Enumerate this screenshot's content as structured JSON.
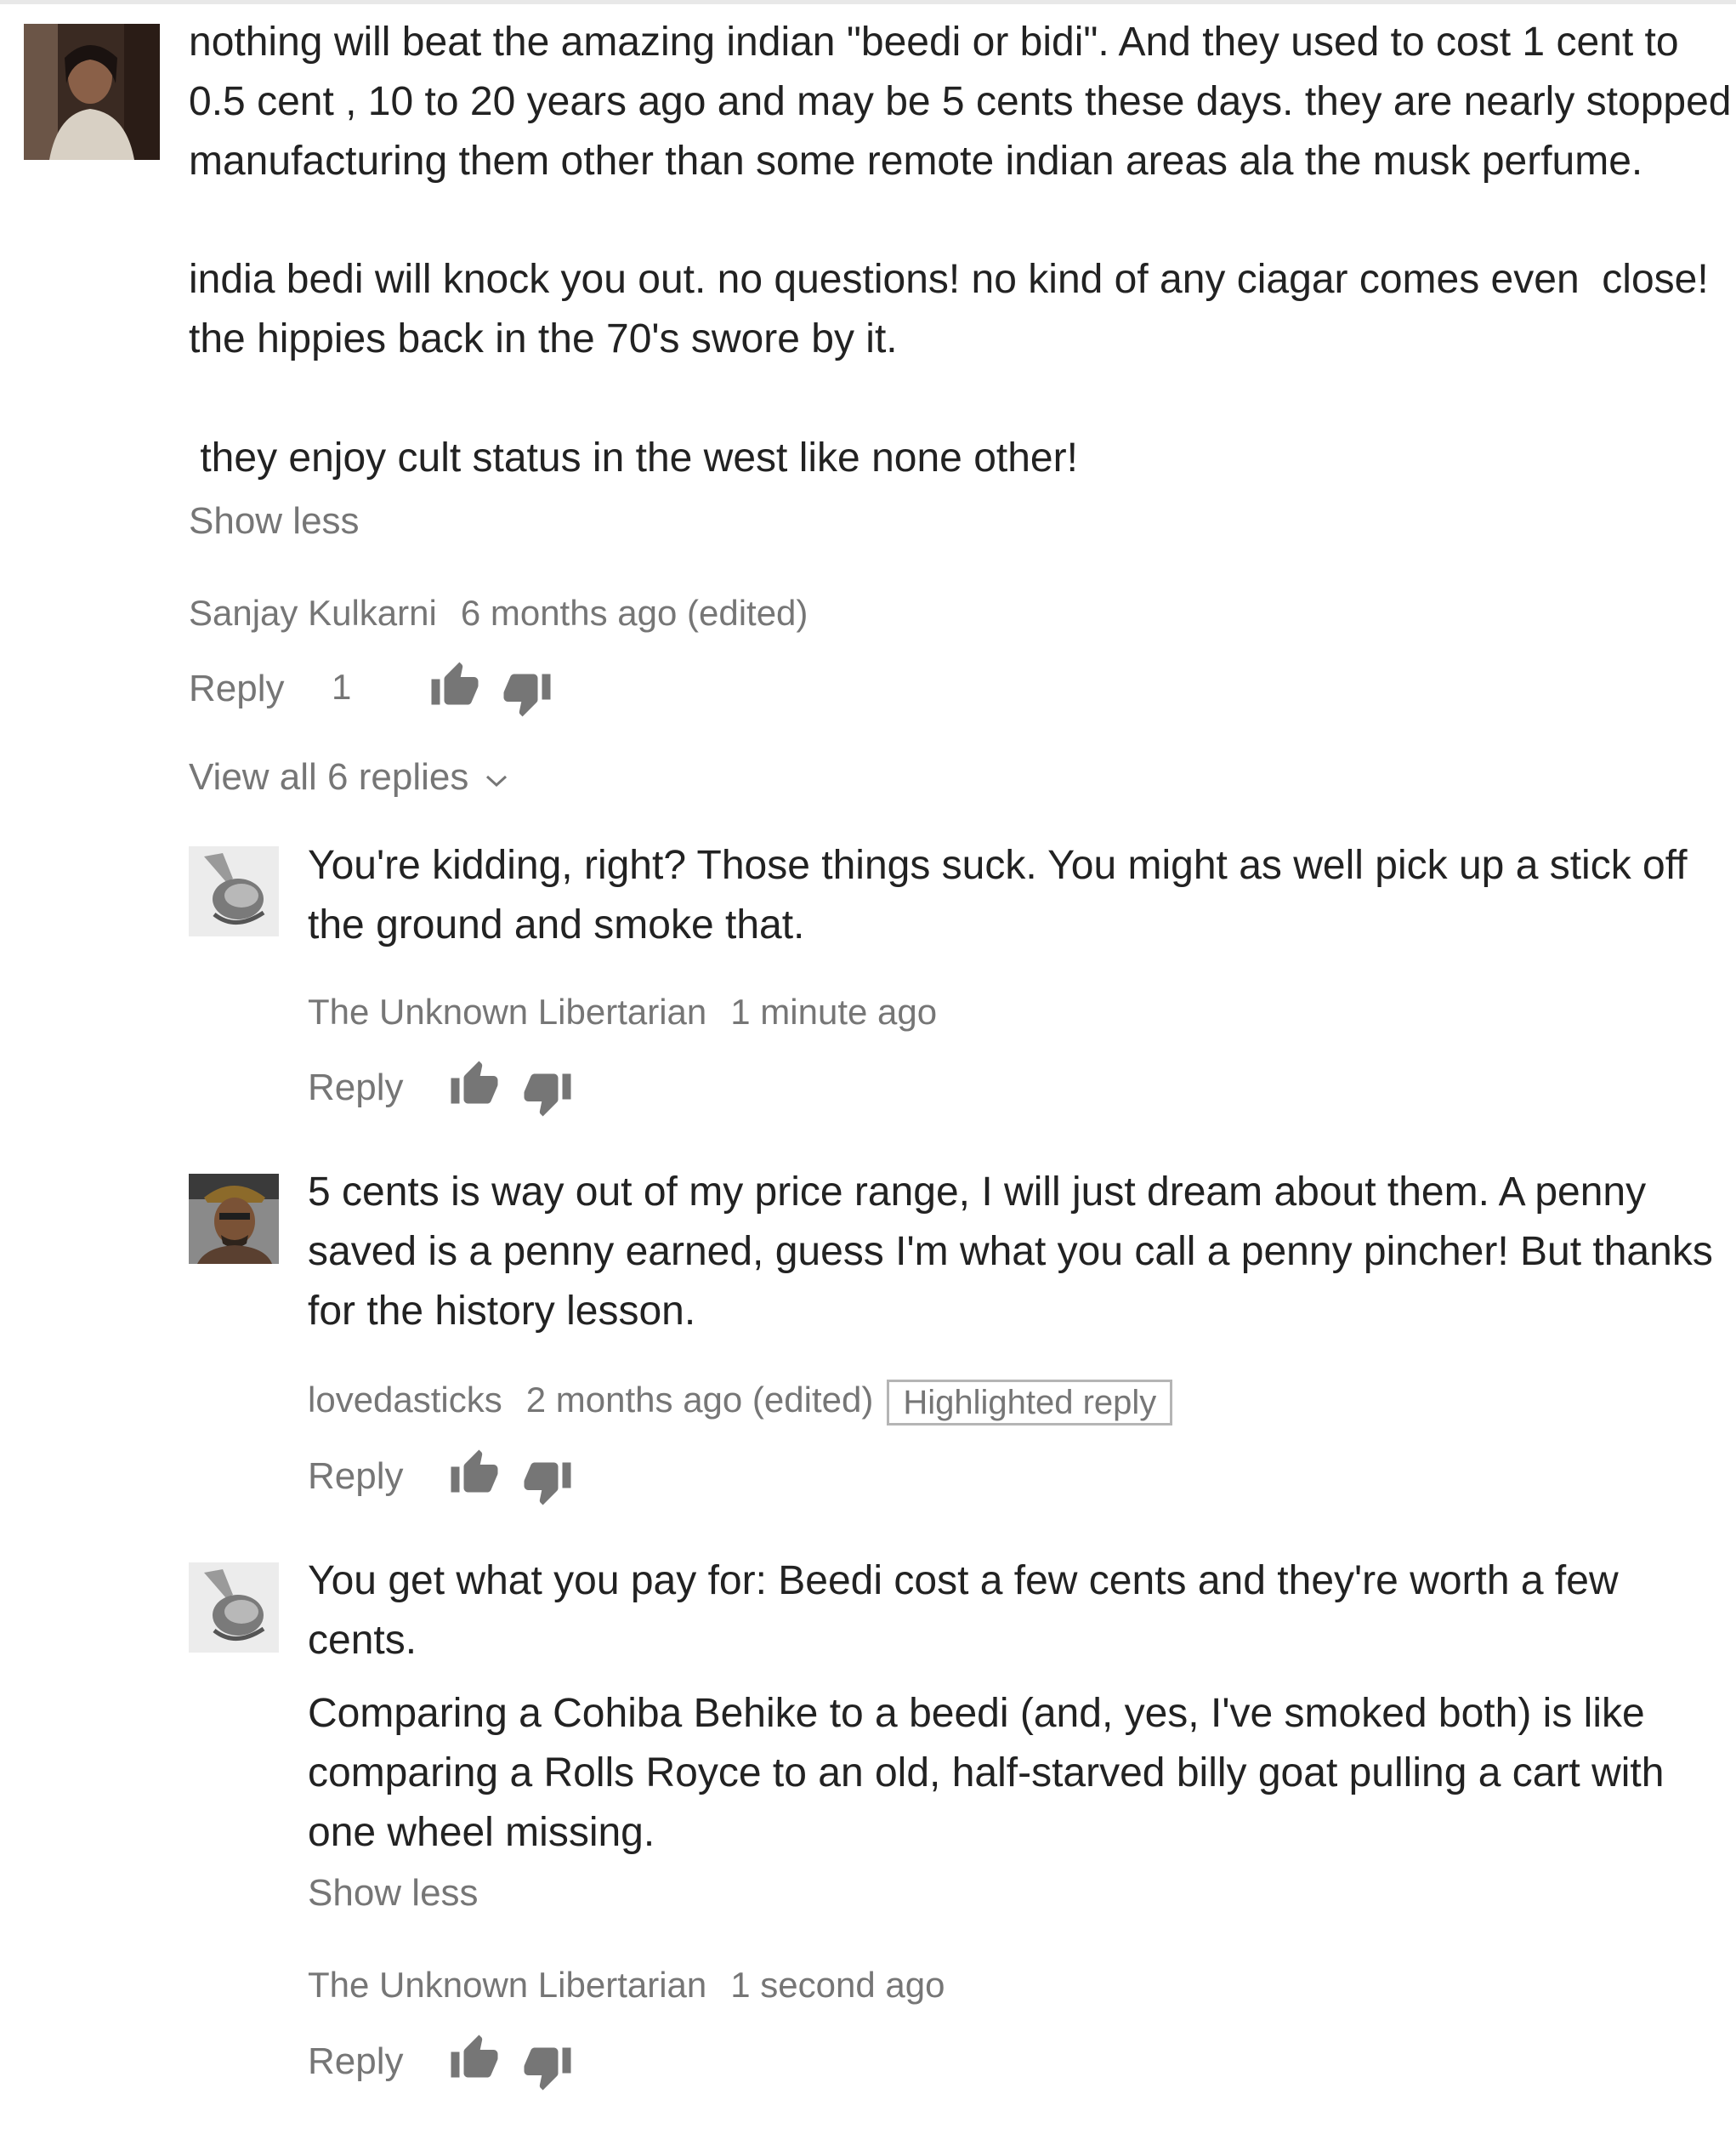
{
  "colors": {
    "text": "#222222",
    "muted": "#767676",
    "badge_border": "#b5b5b5"
  },
  "icons": {
    "like": "thumb-up-icon",
    "dislike": "thumb-down-icon",
    "expand": "chevron-down-icon"
  },
  "comment": {
    "paragraph_1": "nothing will beat the amazing indian \"beedi or bidi\". And they used to cost 1 cent to\n0.5 cent , 10 to 20 years ago and may be 5 cents these days. they are nearly stopped\nmanufacturing them other than some remote indian areas ala the musk perfume.",
    "paragraph_2": "india bedi will knock you out. no questions! no kind of any ciagar comes even  close!\nthe hippies back in the 70's swore by it.",
    "paragraph_3": " they enjoy cult status in the west like none other!",
    "show_less": "Show less",
    "author": "Sanjay Kulkarni",
    "time": "6 months ago (edited)",
    "reply_label": "Reply",
    "like_count": "1",
    "view_replies": "View all 6 replies"
  },
  "replies": [
    {
      "text": "You're kidding, right? Those things suck. You might as well pick up a stick off\nthe ground and smoke that.",
      "author": "The Unknown Libertarian",
      "time": "1 minute ago",
      "reply_label": "Reply"
    },
    {
      "text": "5 cents is way out of my price range, I will just dream about them. A penny\nsaved is a penny earned, guess I'm what you call a penny pincher! But thanks\nfor the history lesson.",
      "author": "lovedasticks",
      "time": "2 months ago (edited)",
      "badge": "Highlighted reply",
      "reply_label": "Reply"
    },
    {
      "text_1": "You get what you pay for: Beedi cost a few cents and they're worth a few\ncents.",
      "text_2": "Comparing a Cohiba Behike to a beedi (and, yes, I've smoked both) is like\ncomparing a Rolls Royce to an old, half-starved billy goat pulling a cart with\none wheel missing.",
      "show_less": "Show less",
      "author": "The Unknown Libertarian",
      "time": "1 second ago",
      "reply_label": "Reply"
    }
  ]
}
